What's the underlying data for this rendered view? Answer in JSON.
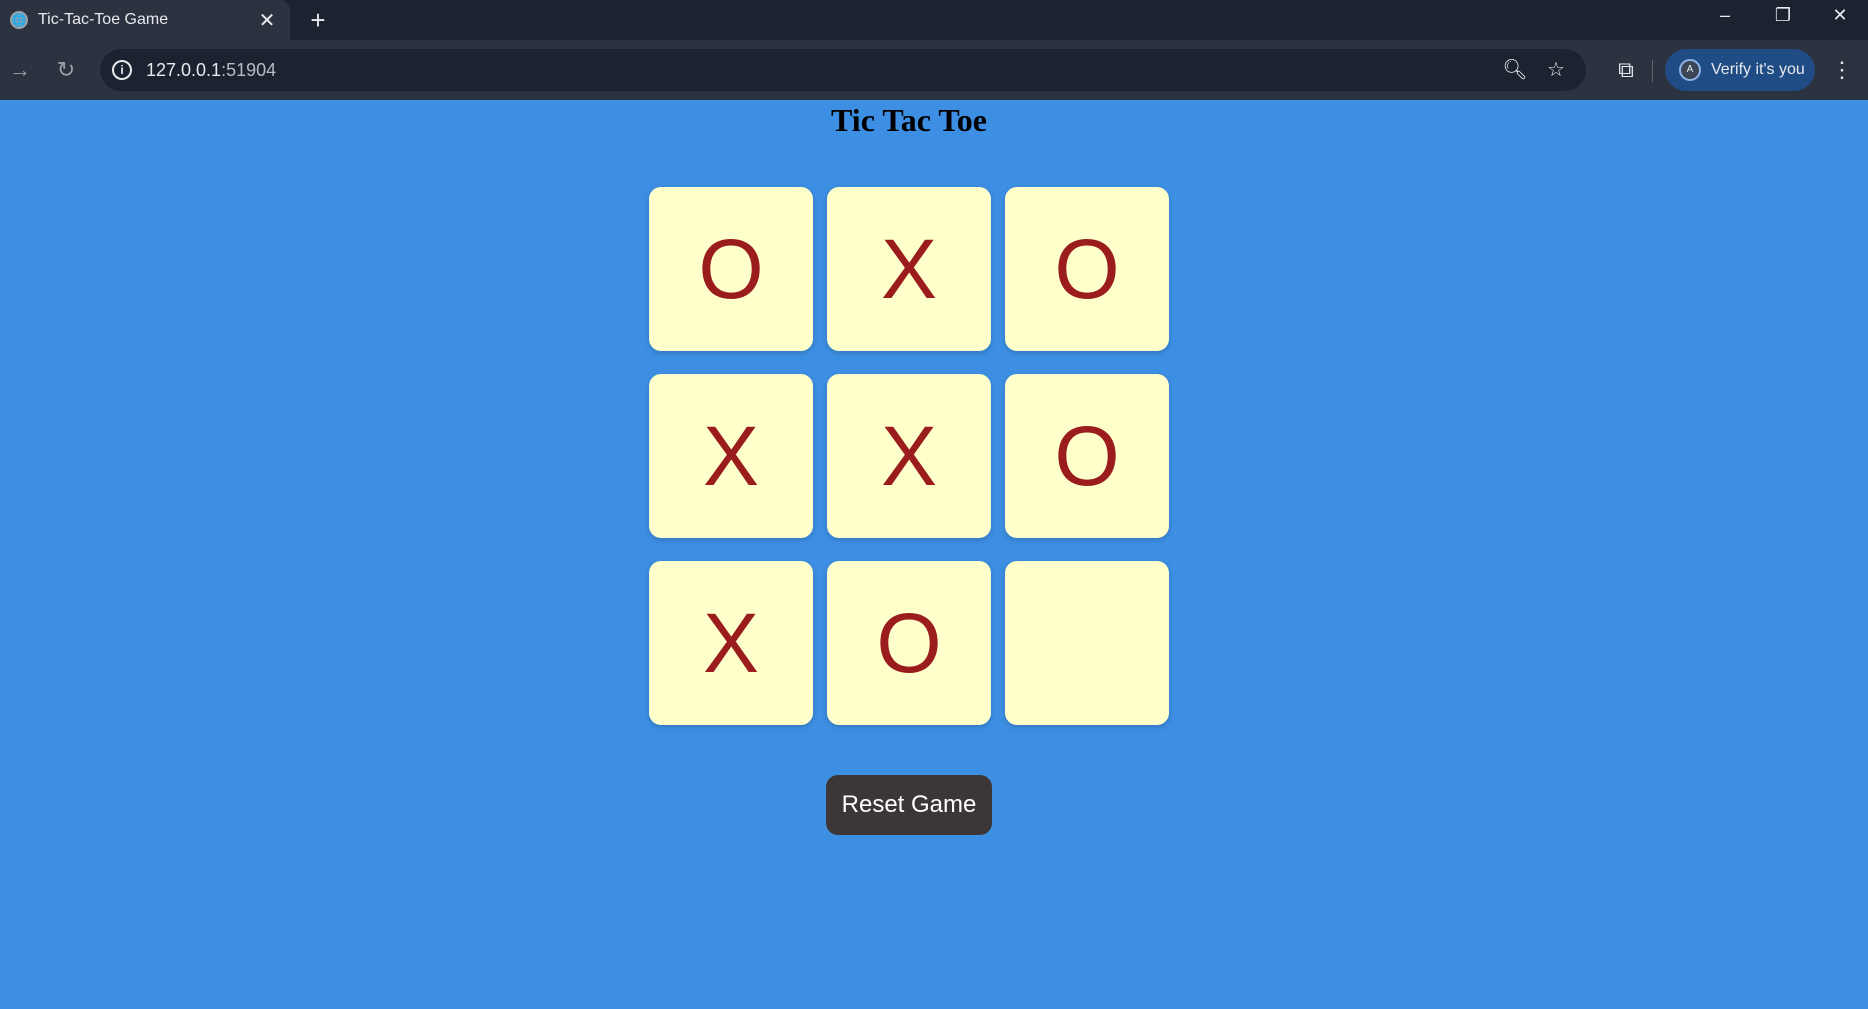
{
  "browser": {
    "tab_title": "Tic-Tac-Toe Game",
    "url_host": "127.0.0.1",
    "url_port": ":51904",
    "profile_label": "Verify it's you",
    "profile_initial": "A"
  },
  "icons": {
    "tab_favicon": "globe-icon",
    "close": "close-icon",
    "new_tab": "plus-icon",
    "back": "arrow-right-icon",
    "reload": "reload-icon",
    "site_info": "info-icon",
    "zoom": "zoom-out-icon",
    "bookmark": "star-icon",
    "extensions": "puzzle-icon",
    "menu": "more-vertical-icon"
  },
  "game": {
    "title": "Tic Tac Toe",
    "board": [
      "O",
      "X",
      "O",
      "X",
      "X",
      "O",
      "X",
      "O",
      ""
    ],
    "reset_label": "Reset Game"
  },
  "colors": {
    "page_background": "#3d8fe4",
    "cell_background": "#ffffcc",
    "mark_color": "#9b1c1c",
    "reset_button": "#3d3636"
  }
}
